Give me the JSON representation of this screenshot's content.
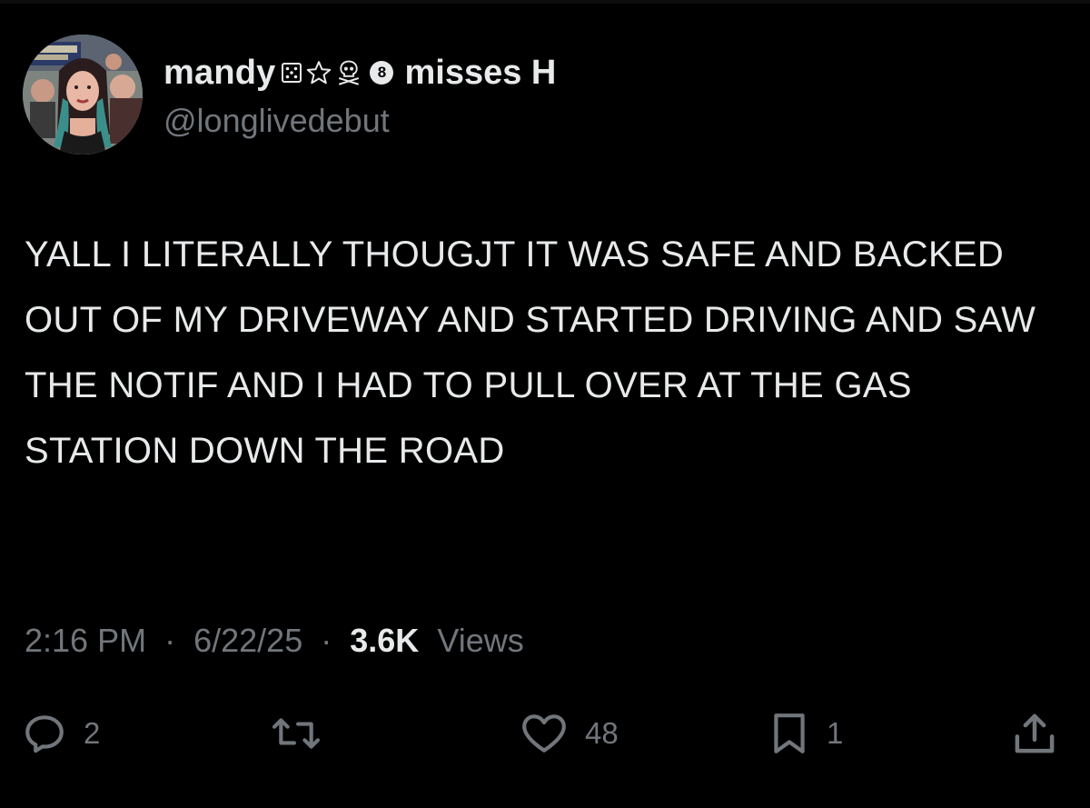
{
  "tweet": {
    "author": {
      "display_name": "mandy",
      "name_suffix": "misses H",
      "badge_number": "8",
      "handle": "@longlivedebut"
    },
    "text": "YALL I LITERALLY THOUGJT IT WAS SAFE AND BACKED OUT OF MY DRIVEWAY AND STARTED DRIVING AND SAW THE NOTIF AND I HAD TO PULL OVER AT THE GAS STATION DOWN THE ROAD",
    "meta": {
      "time": "2:16 PM",
      "separator": "·",
      "date": "6/22/25",
      "views_count": "3.6K",
      "views_label": "Views"
    },
    "actions": {
      "replies": "2",
      "reposts": "",
      "likes": "48",
      "bookmarks": "1"
    }
  },
  "icons": {
    "reply": "reply-icon",
    "repost": "repost-icon",
    "like": "heart-icon",
    "bookmark": "bookmark-icon",
    "share": "share-icon"
  },
  "colors": {
    "background": "#000000",
    "primary_text": "#e7e9ea",
    "secondary_text": "#71767b"
  }
}
